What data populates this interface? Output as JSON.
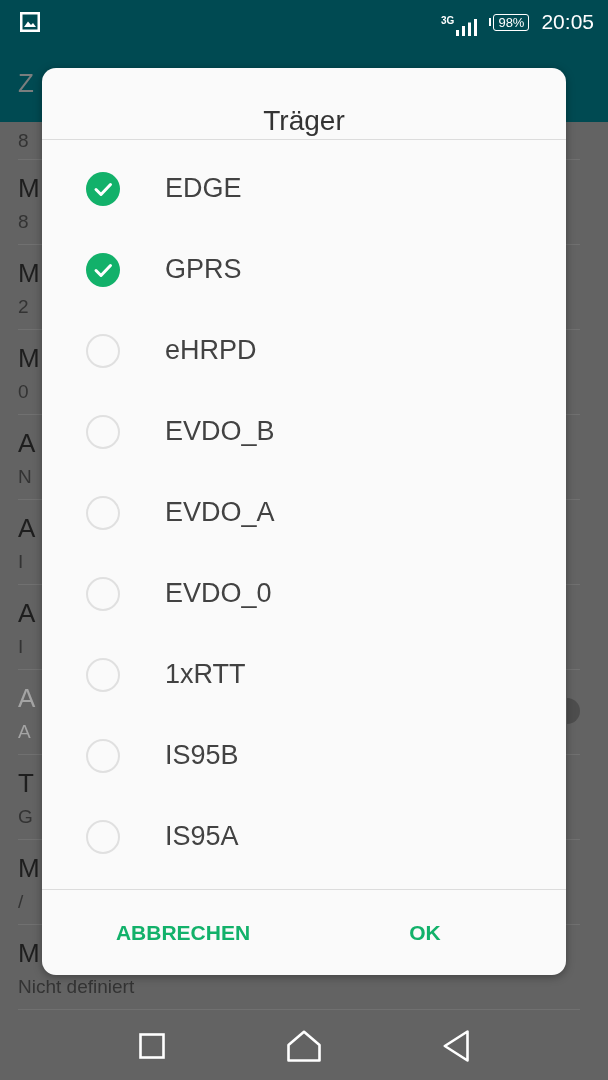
{
  "status_bar": {
    "network": "3G",
    "battery": "98%",
    "time": "20:05"
  },
  "app_bar": {
    "title": "Z"
  },
  "settings_list": [
    {
      "kind": "text",
      "value": "8",
      "disabled": false
    },
    {
      "kind": "text",
      "title": "M",
      "value": "8",
      "disabled": false
    },
    {
      "kind": "text",
      "title": "M",
      "value": "2",
      "disabled": false
    },
    {
      "kind": "text",
      "title": "M",
      "value": "0",
      "disabled": false
    },
    {
      "kind": "text",
      "title": "A",
      "value": "N",
      "disabled": false
    },
    {
      "kind": "text",
      "title": "A",
      "value": "I",
      "disabled": false
    },
    {
      "kind": "text",
      "title": "A",
      "value": "I",
      "disabled": false
    },
    {
      "kind": "toggle",
      "title": "A",
      "value": "A",
      "disabled": true
    },
    {
      "kind": "text",
      "title": "T",
      "value": "G",
      "disabled": false
    },
    {
      "kind": "text",
      "title": "M",
      "value": "/",
      "disabled": false
    },
    {
      "kind": "text",
      "title": "M",
      "value": "Nicht definiert",
      "disabled": false
    }
  ],
  "dialog": {
    "title": "Träger",
    "options": [
      {
        "label": "EDGE",
        "checked": true
      },
      {
        "label": "GPRS",
        "checked": true
      },
      {
        "label": "eHRPD",
        "checked": false
      },
      {
        "label": "EVDO_B",
        "checked": false
      },
      {
        "label": "EVDO_A",
        "checked": false
      },
      {
        "label": "EVDO_0",
        "checked": false
      },
      {
        "label": "1xRTT",
        "checked": false
      },
      {
        "label": "IS95B",
        "checked": false
      },
      {
        "label": "IS95A",
        "checked": false
      }
    ],
    "buttons": [
      "ABBRECHEN",
      "OK"
    ]
  }
}
